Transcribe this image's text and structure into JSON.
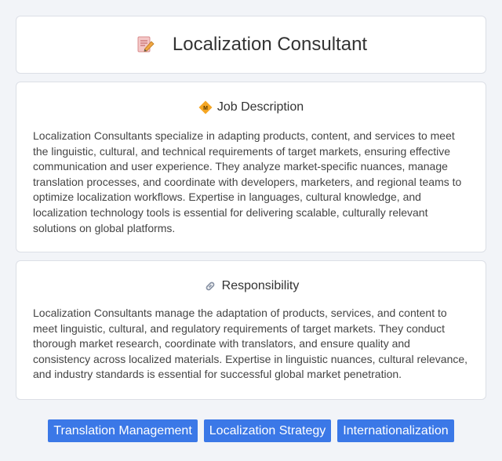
{
  "header": {
    "title": "Localization Consultant",
    "icon": "document-pencil-icon"
  },
  "job_description": {
    "heading": "Job Description",
    "icon": "diamond-badge-icon",
    "text": "Localization Consultants specialize in adapting products, content, and services to meet the linguistic, cultural, and technical requirements of target markets, ensuring effective communication and user experience. They analyze market-specific nuances, manage translation processes, and coordinate with developers, marketers, and regional teams to optimize localization workflows. Expertise in languages, cultural knowledge, and localization technology tools is essential for delivering scalable, culturally relevant solutions on global platforms."
  },
  "responsibility": {
    "heading": "Responsibility",
    "icon": "link-icon",
    "text": "Localization Consultants manage the adaptation of products, services, and content to meet linguistic, cultural, and regulatory requirements of target markets. They conduct thorough market research, coordinate with translators, and ensure quality and consistency across localized materials. Expertise in linguistic nuances, cultural relevance, and industry standards is essential for successful global market penetration."
  },
  "tags": [
    {
      "label": "Translation Management"
    },
    {
      "label": "Localization Strategy"
    },
    {
      "label": "Internationalization"
    }
  ],
  "colors": {
    "background": "#f2f4f8",
    "tag": "#3b78e7"
  }
}
